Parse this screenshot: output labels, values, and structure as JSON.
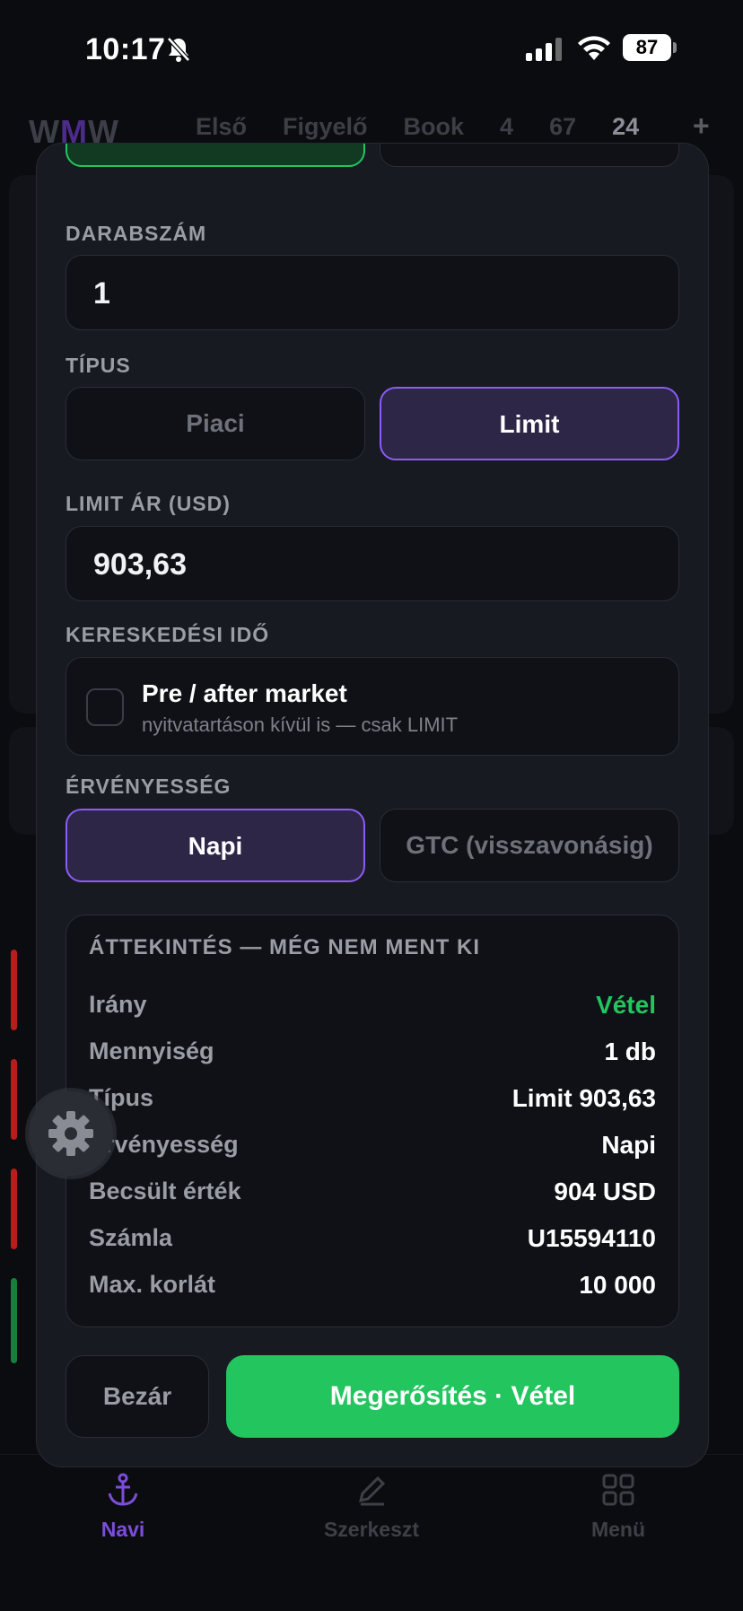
{
  "status_bar": {
    "time": "10:17",
    "battery": "87"
  },
  "app_header": {
    "logo_w1": "W",
    "logo_m": "M",
    "logo_w2": "W",
    "tabs": [
      "Első",
      "Figyelő",
      "Book",
      "4",
      "67",
      "24"
    ],
    "add": "+"
  },
  "order_sheet": {
    "quantity": {
      "label": "DARABSZÁM",
      "value": "1"
    },
    "type": {
      "label": "TÍPUS",
      "options": [
        "Piaci",
        "Limit"
      ],
      "selected": "Limit"
    },
    "limit_price": {
      "label": "LIMIT ÁR (USD)",
      "value": "903,63"
    },
    "trading_time": {
      "label": "KERESKEDÉSI IDŐ",
      "checkbox_title": "Pre / after market",
      "checkbox_subtitle": "nyitvatartáson kívül is — csak LIMIT",
      "checked": false
    },
    "validity": {
      "label": "ÉRVÉNYESSÉG",
      "options": [
        "Napi",
        "GTC (visszavonásig)"
      ],
      "selected": "Napi"
    },
    "summary": {
      "title": "ÁTTEKINTÉS — MÉG NEM MENT KI",
      "rows": [
        {
          "key": "Irány",
          "value": "Vétel"
        },
        {
          "key": "Mennyiség",
          "value": "1 db"
        },
        {
          "key": "Típus",
          "value": "Limit 903,63"
        },
        {
          "key": "Érvényesség",
          "value": "Napi"
        },
        {
          "key": "Becsült érték",
          "value": "904 USD"
        },
        {
          "key": "Számla",
          "value": "U15594110"
        },
        {
          "key": "Max. korlát",
          "value": "10 000"
        }
      ]
    },
    "close_label": "Bezár",
    "confirm_label": "Megerősítés · Vétel"
  },
  "bottom_nav": [
    {
      "label": "Navi",
      "icon": "anchor-icon",
      "active": true
    },
    {
      "label": "Szerkeszt",
      "icon": "pen-icon",
      "active": false
    },
    {
      "label": "Menü",
      "icon": "grid-icon",
      "active": false
    }
  ],
  "colors": {
    "accent": "#8b5cf6",
    "buy": "#22c55e",
    "sell": "#ef4444"
  }
}
